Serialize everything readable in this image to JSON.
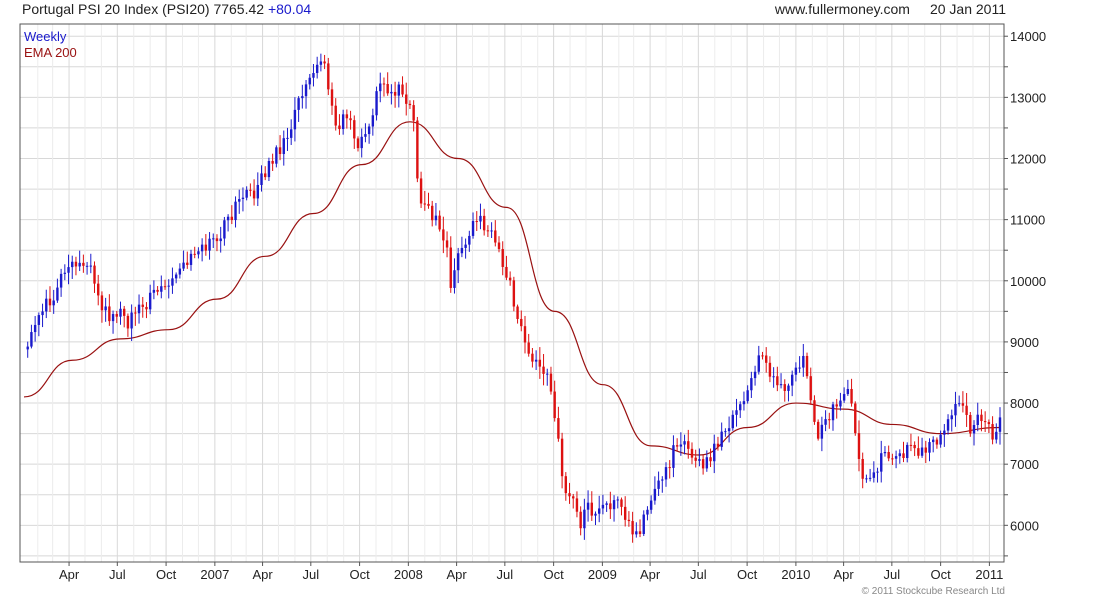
{
  "header": {
    "title": "Portugal PSI 20 Index (PSI20)",
    "last": "7765.42",
    "change": "+80.04",
    "site": "www.fullermoney.com",
    "date": "20 Jan 2011"
  },
  "legend": {
    "line1": "Weekly",
    "line2": "EMA 200"
  },
  "copyright": "© 2011 Stockcube Research Ltd",
  "colors": {
    "up": "#1a1acc",
    "down": "#dd1111",
    "ema": "#991111",
    "grid": "#d8d8d8",
    "frame": "#555555"
  },
  "chart_data": {
    "type": "line",
    "subtype": "weekly candlestick (high-low bars) with EMA 200",
    "ylim": [
      5400,
      14200
    ],
    "y_ticks": [
      6000,
      7000,
      8000,
      9000,
      10000,
      11000,
      12000,
      13000,
      14000
    ],
    "x_ticks": [
      "Apr",
      "Jul",
      "Oct",
      "2007",
      "Apr",
      "Jul",
      "Oct",
      "2008",
      "Apr",
      "Jul",
      "Oct",
      "2009",
      "Apr",
      "Jul",
      "Oct",
      "2010",
      "Apr",
      "Jul",
      "Oct",
      "2011"
    ],
    "x_start": "2006-01-06",
    "x_end": "2011-01-21",
    "grid": true,
    "series": [
      {
        "name": "Weekly",
        "points": [
          [
            "2006-01-06",
            8900
          ],
          [
            "2006-02-03",
            9500
          ],
          [
            "2006-03-03",
            9800
          ],
          [
            "2006-03-24",
            10200
          ],
          [
            "2006-04-14",
            10300
          ],
          [
            "2006-05-05",
            10250
          ],
          [
            "2006-05-19",
            10000
          ],
          [
            "2006-06-02",
            9600
          ],
          [
            "2006-06-16",
            9400
          ],
          [
            "2006-07-07",
            9500
          ],
          [
            "2006-07-21",
            9300
          ],
          [
            "2006-08-11",
            9500
          ],
          [
            "2006-09-01",
            9700
          ],
          [
            "2006-09-22",
            9900
          ],
          [
            "2006-10-13",
            10100
          ],
          [
            "2006-11-03",
            10300
          ],
          [
            "2006-11-24",
            10400
          ],
          [
            "2006-12-15",
            10600
          ],
          [
            "2007-01-05",
            10700
          ],
          [
            "2007-01-26",
            11000
          ],
          [
            "2007-02-16",
            11300
          ],
          [
            "2007-03-02",
            11600
          ],
          [
            "2007-03-16",
            11300
          ],
          [
            "2007-04-06",
            11800
          ],
          [
            "2007-04-27",
            12100
          ],
          [
            "2007-05-18",
            12400
          ],
          [
            "2007-06-08",
            12900
          ],
          [
            "2007-06-29",
            13200
          ],
          [
            "2007-07-13",
            13500
          ],
          [
            "2007-07-20",
            13700
          ],
          [
            "2007-08-03",
            13200
          ],
          [
            "2007-08-17",
            12500
          ],
          [
            "2007-09-07",
            12700
          ],
          [
            "2007-09-28",
            12200
          ],
          [
            "2007-10-12",
            12400
          ],
          [
            "2007-10-26",
            12800
          ],
          [
            "2007-11-09",
            13300
          ],
          [
            "2007-11-30",
            13000
          ],
          [
            "2007-12-14",
            13100
          ],
          [
            "2007-12-28",
            13000
          ],
          [
            "2008-01-11",
            12600
          ],
          [
            "2008-01-18",
            11800
          ],
          [
            "2008-01-25",
            11300
          ],
          [
            "2008-02-08",
            11200
          ],
          [
            "2008-02-29",
            10900
          ],
          [
            "2008-03-14",
            10500
          ],
          [
            "2008-03-21",
            9900
          ],
          [
            "2008-04-04",
            10400
          ],
          [
            "2008-04-25",
            10800
          ],
          [
            "2008-05-16",
            11000
          ],
          [
            "2008-06-06",
            10800
          ],
          [
            "2008-06-20",
            10500
          ],
          [
            "2008-07-04",
            10100
          ],
          [
            "2008-07-18",
            9700
          ],
          [
            "2008-08-01",
            9200
          ],
          [
            "2008-08-15",
            8800
          ],
          [
            "2008-08-29",
            8600
          ],
          [
            "2008-09-12",
            8500
          ],
          [
            "2008-09-26",
            8300
          ],
          [
            "2008-10-10",
            7400
          ],
          [
            "2008-10-24",
            6400
          ],
          [
            "2008-11-07",
            6500
          ],
          [
            "2008-11-21",
            6000
          ],
          [
            "2008-12-05",
            6300
          ],
          [
            "2008-12-19",
            6200
          ],
          [
            "2009-01-09",
            6400
          ],
          [
            "2009-01-30",
            6300
          ],
          [
            "2009-02-20",
            6000
          ],
          [
            "2009-03-06",
            5800
          ],
          [
            "2009-03-20",
            6100
          ],
          [
            "2009-04-03",
            6400
          ],
          [
            "2009-04-24",
            6800
          ],
          [
            "2009-05-15",
            7200
          ],
          [
            "2009-06-05",
            7300
          ],
          [
            "2009-06-26",
            7100
          ],
          [
            "2009-07-17",
            7000
          ],
          [
            "2009-07-31",
            7300
          ],
          [
            "2009-08-21",
            7600
          ],
          [
            "2009-09-11",
            7900
          ],
          [
            "2009-10-02",
            8200
          ],
          [
            "2009-10-16",
            8600
          ],
          [
            "2009-10-30",
            8700
          ],
          [
            "2009-11-20",
            8400
          ],
          [
            "2009-12-11",
            8200
          ],
          [
            "2009-12-31",
            8500
          ],
          [
            "2010-01-15",
            8700
          ],
          [
            "2010-01-29",
            8000
          ],
          [
            "2010-02-12",
            7500
          ],
          [
            "2010-03-05",
            7800
          ],
          [
            "2010-03-26",
            8100
          ],
          [
            "2010-04-09",
            8200
          ],
          [
            "2010-04-23",
            7600
          ],
          [
            "2010-05-07",
            6800
          ],
          [
            "2010-05-21",
            6900
          ],
          [
            "2010-06-04",
            7000
          ],
          [
            "2010-06-25",
            7200
          ],
          [
            "2010-07-16",
            7100
          ],
          [
            "2010-08-06",
            7300
          ],
          [
            "2010-08-27",
            7200
          ],
          [
            "2010-09-17",
            7300
          ],
          [
            "2010-10-08",
            7600
          ],
          [
            "2010-10-29",
            8000
          ],
          [
            "2010-11-12",
            7900
          ],
          [
            "2010-11-26",
            7600
          ],
          [
            "2010-12-10",
            7800
          ],
          [
            "2010-12-31",
            7700
          ],
          [
            "2011-01-07",
            7400
          ],
          [
            "2011-01-21",
            7765
          ]
        ]
      },
      {
        "name": "EMA 200",
        "points": [
          [
            "2006-01-06",
            8100
          ],
          [
            "2006-04-07",
            8700
          ],
          [
            "2006-07-07",
            9050
          ],
          [
            "2006-10-06",
            9200
          ],
          [
            "2007-01-05",
            9700
          ],
          [
            "2007-04-06",
            10400
          ],
          [
            "2007-07-06",
            11100
          ],
          [
            "2007-10-05",
            11900
          ],
          [
            "2008-01-04",
            12600
          ],
          [
            "2008-04-04",
            12000
          ],
          [
            "2008-07-04",
            11200
          ],
          [
            "2008-10-03",
            9500
          ],
          [
            "2009-01-02",
            8300
          ],
          [
            "2009-04-03",
            7300
          ],
          [
            "2009-07-03",
            7150
          ],
          [
            "2009-10-02",
            7600
          ],
          [
            "2010-01-01",
            8000
          ],
          [
            "2010-04-02",
            7900
          ],
          [
            "2010-07-02",
            7650
          ],
          [
            "2010-10-01",
            7500
          ],
          [
            "2011-01-21",
            7600
          ]
        ]
      }
    ]
  }
}
